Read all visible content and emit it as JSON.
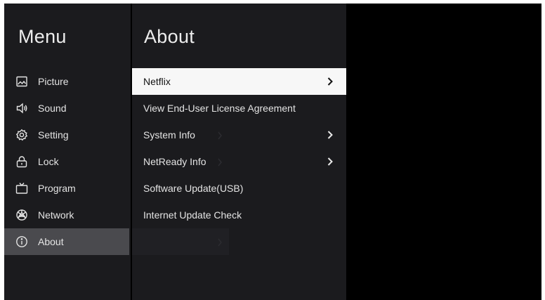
{
  "menu": {
    "title": "Menu",
    "items": [
      {
        "label": "Picture",
        "icon": "picture-icon"
      },
      {
        "label": "Sound",
        "icon": "speaker-icon"
      },
      {
        "label": "Setting",
        "icon": "gear-icon"
      },
      {
        "label": "Lock",
        "icon": "lock-icon"
      },
      {
        "label": "Program",
        "icon": "tv-icon"
      },
      {
        "label": "Network",
        "icon": "network-icon"
      },
      {
        "label": "About",
        "icon": "info-icon",
        "selected": true
      }
    ]
  },
  "about": {
    "title": "About",
    "items": [
      {
        "label": "Netflix",
        "has_submenu": true,
        "focused": true
      },
      {
        "label": "View End-User License Agreement",
        "has_submenu": false
      },
      {
        "label": "System Info",
        "has_submenu": true
      },
      {
        "label": "NetReady Info",
        "has_submenu": true
      },
      {
        "label": "Software Update(USB)",
        "has_submenu": false
      },
      {
        "label": "Internet Update Check",
        "has_submenu": false
      }
    ]
  },
  "colors": {
    "panel_bg": "#1b1b1e",
    "screen_bg": "#000000",
    "selected_bg": "#4a4a4e",
    "focused_bg": "#f7f7f7",
    "text": "#e4e4e4"
  }
}
